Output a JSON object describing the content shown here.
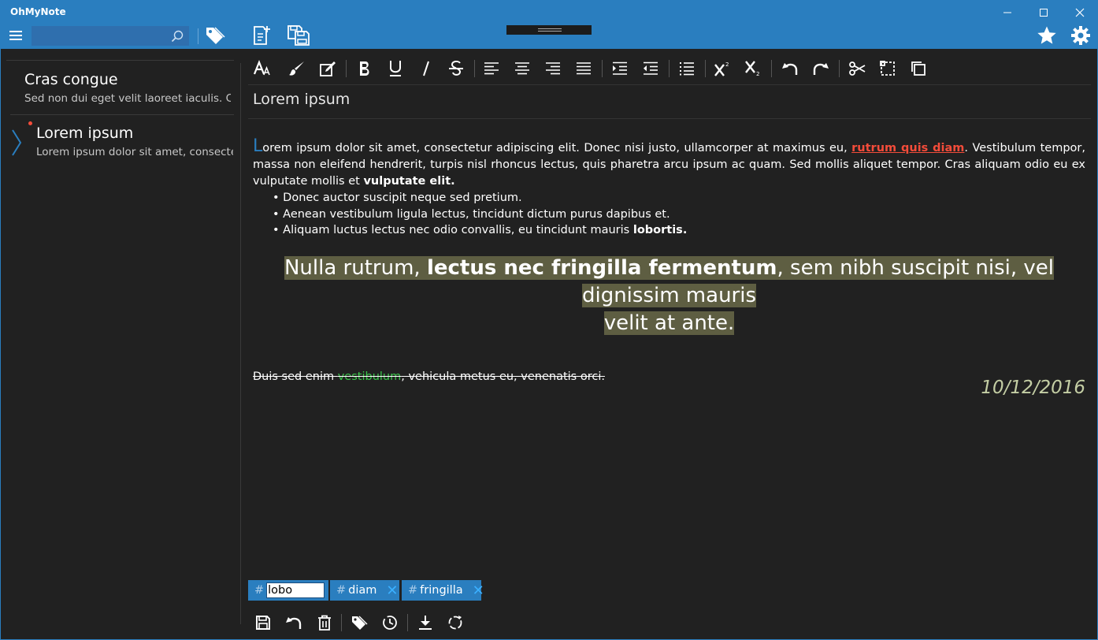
{
  "app": {
    "title": "OhMyNote"
  },
  "search": {
    "placeholder": "",
    "value": ""
  },
  "notes": [
    {
      "title": "Cras congue",
      "preview": "Sed non dui eget velit laoreet iaculis. Cras congue"
    },
    {
      "title": "Lorem ipsum",
      "preview": "Lorem ipsum dolor sit amet, consectetur adipiscing",
      "selected": true,
      "modified": true
    }
  ],
  "editor": {
    "title": "Lorem ipsum",
    "para1": {
      "drop": "L",
      "text1": "orem ipsum dolor sit amet, consectetur adipiscing elit. Donec nisi justo, ullamcorper at maximus eu, ",
      "link": "rutrum quis diam",
      "text2": ". Vestibulum tempor, massa non eleifend hendrerit, turpis nisl rhoncus lectus, quis pharetra arcu ipsum ac quam. Sed mollis aliquet tempor. Cras aliquam odio eu ex vulputate mollis et ",
      "bold": "vulputate elit",
      "end": "."
    },
    "bullets": [
      {
        "text": "• Donec auctor suscipit neque sed pretium.",
        "bold": ""
      },
      {
        "text": "• Aenean vestibulum ligula lectus, tincidunt dictum purus dapibus et.",
        "bold": ""
      },
      {
        "text": "• Aliquam luctus lectus nec odio convallis, eu tincidunt mauris ",
        "bold": "lobortis",
        "end": "."
      }
    ],
    "heading": {
      "pre": "Nulla rutrum, ",
      "bold": "lectus nec fringilla fermentum",
      "post1": ", sem nibh suscipit nisi, vel dignissim mauris",
      "post2": "velit at ante."
    },
    "strike": {
      "pre": "Duis sed enim ",
      "green": "vestibulum",
      "post": ", vehicula metus eu, venenatis orci."
    },
    "date": "10/12/2016"
  },
  "tags": {
    "hash": "#",
    "input_value": "lobo",
    "items": [
      {
        "label": "diam"
      },
      {
        "label": "fringilla"
      }
    ],
    "remove_glyph": "✕"
  },
  "colors": {
    "accent": "#2a7ebf",
    "background": "#212121",
    "link": "#f44c3a",
    "highlight": "#5e5e42",
    "green": "#3ac34a"
  }
}
